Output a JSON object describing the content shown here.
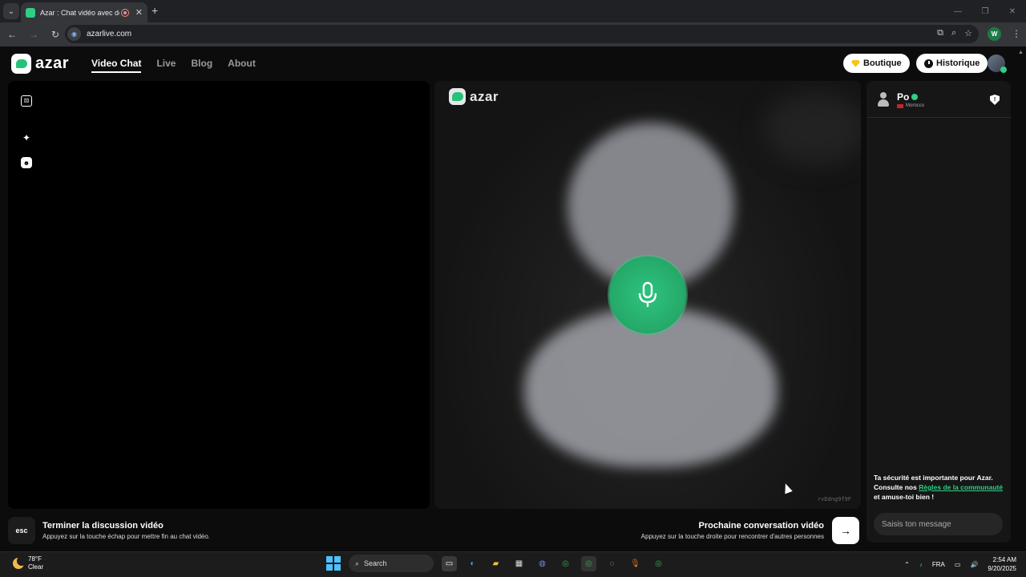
{
  "browser": {
    "tab_title": "Azar : Chat vidéo avec de n",
    "url": "azarlive.com",
    "profile_initial": "W"
  },
  "site": {
    "logo_text": "azar",
    "nav": [
      {
        "label": "Video Chat",
        "active": true
      },
      {
        "label": "Live",
        "active": false
      },
      {
        "label": "Blog",
        "active": false
      },
      {
        "label": "About",
        "active": false
      }
    ],
    "boutique_label": "Boutique",
    "historique_label": "Historique"
  },
  "peer": {
    "logo_text": "azar",
    "session_code": "rvDdng9f9F"
  },
  "chat": {
    "name": "Po",
    "country": "Morocco",
    "safety_text_1": "Ta sécurité est importante pour Azar. Consulte nos ",
    "safety_link": "Règles de la communauté",
    "safety_text_2": " et amuse-toi bien !",
    "input_placeholder": "Saisis ton message"
  },
  "controls": {
    "esc_key": "esc",
    "end_title": "Terminer la discussion vidéo",
    "end_subtitle": "Appuyez sur la touche échap pour mettre fin au chat vidéo.",
    "next_title": "Prochaine conversation vidéo",
    "next_subtitle": "Appuyez sur la touche droite pour rencontrer d'autres personnes"
  },
  "taskbar": {
    "temperature": "78°F",
    "weather": "Clear",
    "search_label": "Search",
    "language": "FRA",
    "time": "2:54 AM",
    "date": "9/20/2025"
  },
  "colors": {
    "accent": "#2ecf84",
    "mic_green": "#27b572"
  }
}
